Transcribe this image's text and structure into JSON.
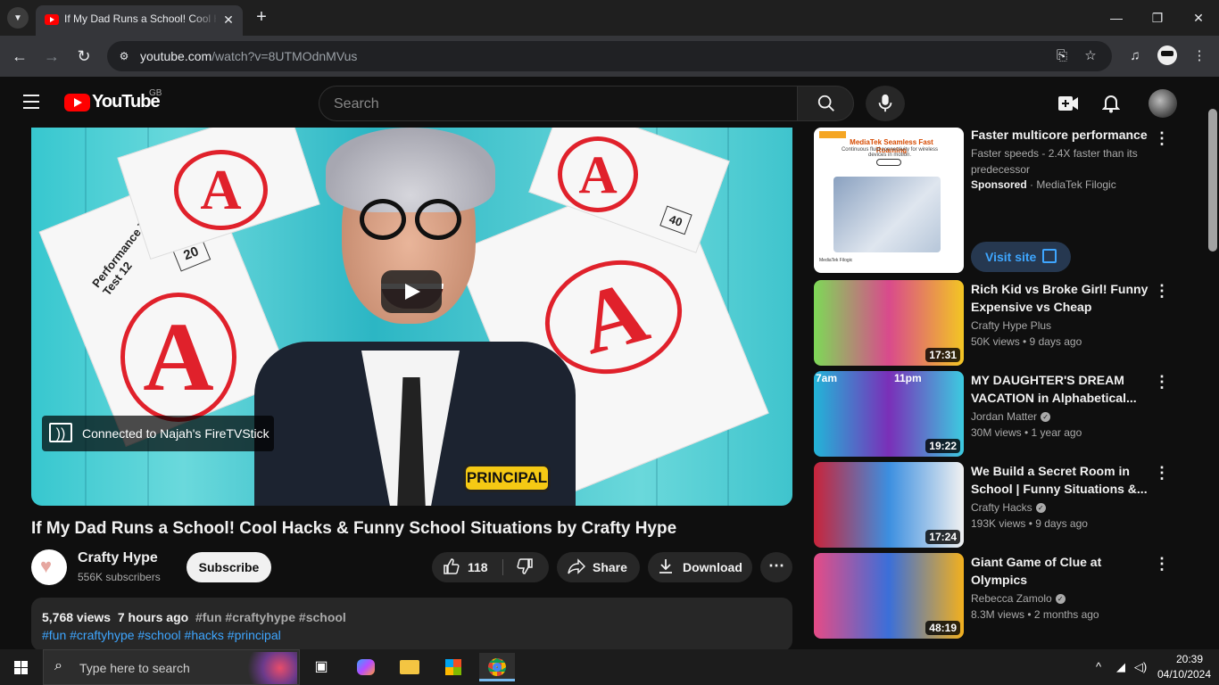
{
  "browser": {
    "tab_title": "If My Dad Runs a School! Cool Hacks & Funny School Situations by Crafty Hype",
    "tab_close": "✕",
    "new_tab": "+",
    "url_host": "youtube.com",
    "url_path": "/watch?v=8UTMOdnMVus",
    "window_controls": {
      "minimize": "—",
      "maximize": "❐",
      "close": "✕"
    }
  },
  "youtube": {
    "logo_text": "YouTube",
    "region": "GB",
    "search_placeholder": "Search"
  },
  "player": {
    "cast_status": "Connected to Najah's FireTVStick",
    "thumbnail_badge": "PRINCIPAL",
    "paper_titles": [
      "Performance Task Test 12",
      "20",
      "40"
    ]
  },
  "video": {
    "title": "If My Dad Runs a School! Cool Hacks & Funny School Situations by Crafty Hype",
    "channel_name": "Crafty Hype",
    "subscribers": "556K subscribers",
    "subscribe_label": "Subscribe",
    "like_count": "118",
    "share_label": "Share",
    "download_label": "Download",
    "more_label": "⋯",
    "views": "5,768 views",
    "posted": "7 hours ago",
    "tags_inline": "#fun #craftyhype #school",
    "hashtags": "#fun #craftyhype #school #hacks #principal"
  },
  "ad": {
    "title": "Faster multicore performance",
    "description": "Faster speeds - 2.4X faster than its predecessor",
    "sponsored_label": "Sponsored",
    "advertiser": "MediaTek Filogic",
    "visit_label": "Visit site",
    "thumb_headline": "MediaTek Seamless Fast Roaming",
    "thumb_sub": "Continuous fluid connectivity for wireless devices in motion.",
    "thumb_brand": "MediaTek Filogic"
  },
  "recommendations": [
    {
      "title": "Rich Kid vs Broke Girl! Funny Expensive vs Cheap Situation...",
      "channel": "Crafty Hype Plus",
      "verified": false,
      "meta": "50K views • 9 days ago",
      "duration": "17:31",
      "colors": [
        "#7ed957",
        "#d94a8c",
        "#f3c623"
      ]
    },
    {
      "title": "MY DAUGHTER'S DREAM VACATION in Alphabetical...",
      "channel": "Jordan Matter",
      "verified": true,
      "meta": "30M views • 1 year ago",
      "duration": "19:22",
      "colors": [
        "#22b5d8",
        "#7a2fb8",
        "#3ccbe0"
      ],
      "overlay_left": "7am",
      "overlay_right": "11pm"
    },
    {
      "title": "We Build a Secret Room in School | Funny Situations &...",
      "channel": "Crafty Hacks",
      "verified": true,
      "meta": "193K views • 9 days ago",
      "duration": "17:24",
      "colors": [
        "#c9243a",
        "#3c8fe0",
        "#f1f1f1"
      ]
    },
    {
      "title": "Giant Game of Clue at Olympics",
      "channel": "Rebecca Zamolo",
      "verified": true,
      "meta": "8.3M views • 2 months ago",
      "duration": "48:19",
      "colors": [
        "#e64b86",
        "#3b6fd9",
        "#f2b01e"
      ]
    }
  ],
  "taskbar": {
    "search_placeholder": "Type here to search",
    "time": "20:39",
    "date": "04/10/2024"
  },
  "icons": {
    "menu": "hamburger-icon",
    "search": "search-icon",
    "mic": "mic-icon",
    "create": "create-video-icon",
    "notifications": "bell-icon"
  },
  "colors": {
    "background": "#0f0f0f",
    "brand_red": "#ff0000",
    "link_blue": "#3ea6ff"
  }
}
